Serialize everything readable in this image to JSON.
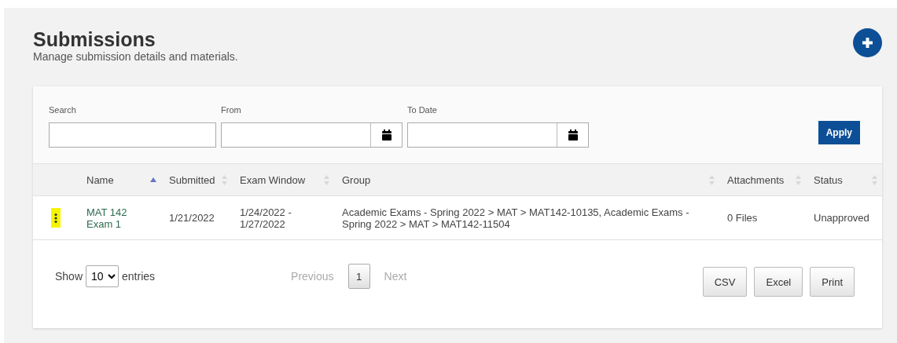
{
  "header": {
    "title": "Submissions",
    "subtitle": "Manage submission details and materials."
  },
  "filters": {
    "fields": [
      {
        "label": "Search",
        "kind": "text"
      },
      {
        "label": "From",
        "kind": "date"
      },
      {
        "label": "To Date",
        "kind": "date"
      }
    ],
    "apply": "Apply"
  },
  "table": {
    "columns": [
      {
        "label": "Name",
        "sorted": true
      },
      {
        "label": "Submitted",
        "sorted": false
      },
      {
        "label": "Exam Window",
        "sorted": false
      },
      {
        "label": "Group",
        "sorted": false
      },
      {
        "label": "Attachments",
        "sorted": false
      },
      {
        "label": "Status",
        "sorted": false
      }
    ],
    "rows": [
      {
        "highlighted": true,
        "name": "MAT 142 Exam 1",
        "submitted": "1/21/2022",
        "exam_window": "1/24/2022 - 1/27/2022",
        "group": "Academic Exams - Spring 2022 > MAT > MAT142-10135, Academic Exams - Spring 2022 > MAT > MAT142-11504",
        "attachments": "0 Files",
        "status": "Unapproved"
      }
    ]
  },
  "footer": {
    "show": "Show",
    "page_size": "10",
    "entries": "entries",
    "previous": "Previous",
    "pages": [
      {
        "label": "1",
        "selected": true
      }
    ],
    "next": "Next",
    "exports": [
      "CSV",
      "Excel",
      "Print"
    ]
  }
}
